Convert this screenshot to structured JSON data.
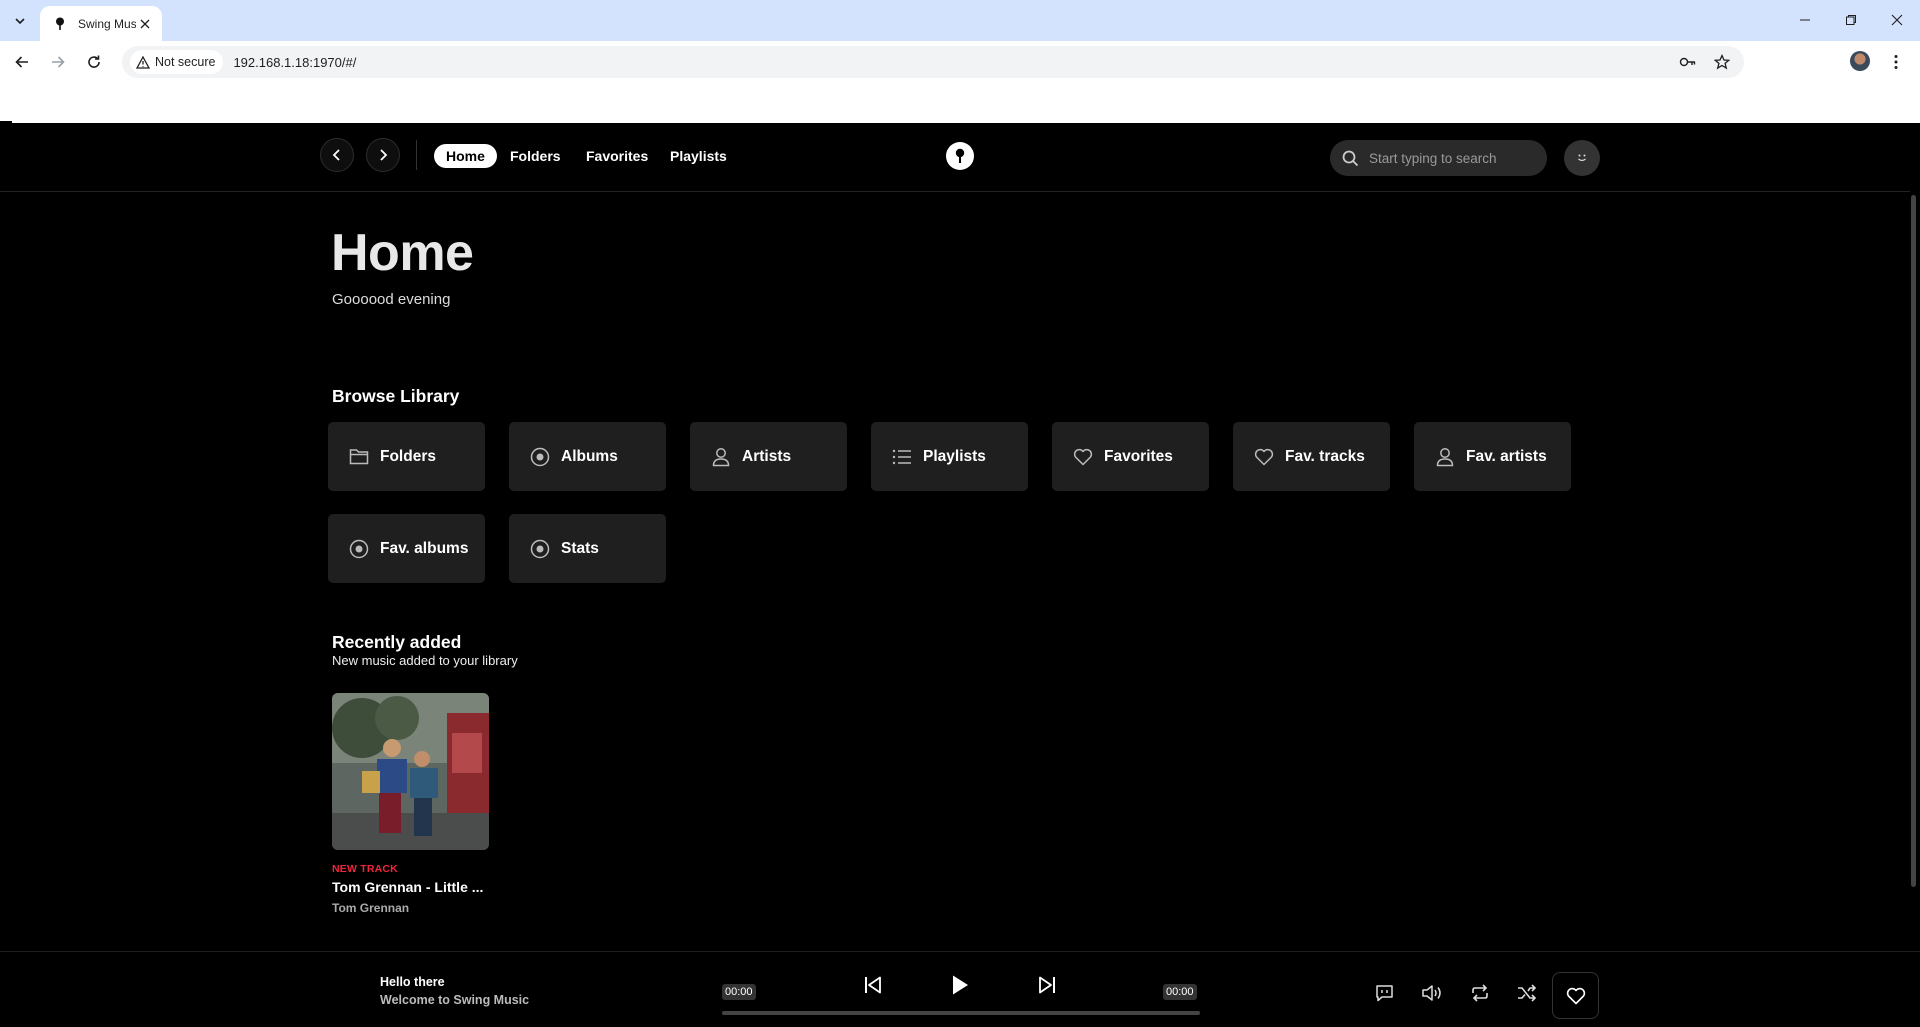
{
  "browser": {
    "tab_title": "Swing Music",
    "security_label": "Not secure",
    "url": "192.168.1.18:1970/#/"
  },
  "nav": {
    "links": [
      "Home",
      "Folders",
      "Favorites",
      "Playlists"
    ],
    "active": "Home",
    "search_placeholder": "Start typing to search"
  },
  "home": {
    "title": "Home",
    "greeting": "Goooood evening"
  },
  "browse": {
    "title": "Browse Library",
    "items": [
      {
        "label": "Folders",
        "icon": "folder-icon"
      },
      {
        "label": "Albums",
        "icon": "album-icon"
      },
      {
        "label": "Artists",
        "icon": "artist-icon"
      },
      {
        "label": "Playlists",
        "icon": "playlist-icon"
      },
      {
        "label": "Favorites",
        "icon": "heart-icon"
      },
      {
        "label": "Fav. tracks",
        "icon": "heart-icon"
      },
      {
        "label": "Fav. artists",
        "icon": "artist-icon"
      },
      {
        "label": "Fav. albums",
        "icon": "album-icon"
      },
      {
        "label": "Stats",
        "icon": "album-icon"
      }
    ]
  },
  "recent": {
    "title": "Recently added",
    "subtitle": "New music added to your library",
    "items": [
      {
        "badge": "NEW TRACK",
        "title": "Tom Grennan - Little ...",
        "artist": "Tom Grennan"
      }
    ]
  },
  "player": {
    "title": "Hello there",
    "subtitle": "Welcome to Swing Music",
    "elapsed": "00:00",
    "duration": "00:00",
    "progress": 0
  },
  "colors": {
    "accent_badge": "#f0243b",
    "tile_bg": "#1f1f1f"
  }
}
